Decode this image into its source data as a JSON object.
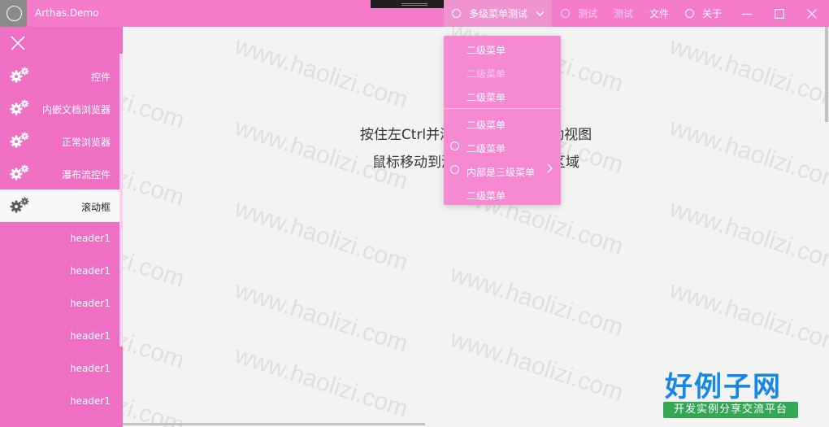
{
  "window": {
    "title": "Arthas.Demo",
    "accent": "#f57ccb"
  },
  "menubar": {
    "items": [
      {
        "label": "多级菜单测试",
        "icon": "circle-icon",
        "has_chevron": true
      },
      {
        "label": "测试",
        "icon": "circle-icon",
        "disabled": true
      },
      {
        "label": "测试",
        "disabled": true
      },
      {
        "label": "文件"
      },
      {
        "label": "关于",
        "icon": "circle-icon"
      }
    ]
  },
  "dropdown": {
    "items": [
      {
        "label": "二级菜单"
      },
      {
        "label": "二级菜单",
        "disabled": true
      },
      {
        "label": "二级菜单"
      },
      {
        "label": "二级菜单"
      },
      {
        "label": "二级菜单",
        "icon": "circle-icon"
      },
      {
        "label": "内部是三级菜单",
        "icon": "circle-icon",
        "submenu": true
      },
      {
        "label": "二级菜单"
      }
    ]
  },
  "sidebar": {
    "items": [
      {
        "label": "控件",
        "icon": "gears-icon"
      },
      {
        "label": "内嵌文档浏览器",
        "icon": "gears-icon"
      },
      {
        "label": "正常浏览器",
        "icon": "gears-icon"
      },
      {
        "label": "瀑布流控件",
        "icon": "gears-icon"
      },
      {
        "label": "滚动框",
        "icon": "gears-icon",
        "selected": true
      },
      {
        "label": "header1"
      },
      {
        "label": "header1"
      },
      {
        "label": "header1"
      },
      {
        "label": "header1"
      },
      {
        "label": "header1"
      },
      {
        "label": "header1"
      }
    ]
  },
  "main": {
    "line1": "按住左Ctrl并滚动，可以横向滚动视图",
    "line2": "鼠标移动到滚动条，出现操作区域"
  },
  "watermark": {
    "text": "www.haolizi.com"
  },
  "logo": {
    "main": "好例子网",
    "sub": "开发实例分享交流平台"
  }
}
